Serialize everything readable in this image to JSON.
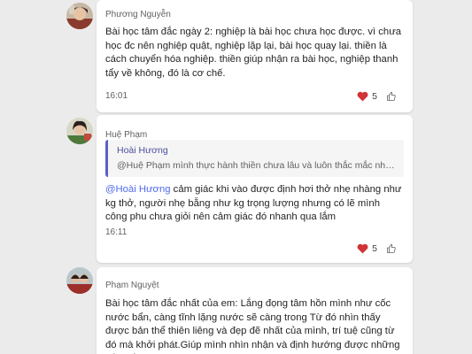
{
  "messages": [
    {
      "author": "Phương Nguyễn",
      "text": "Bài học tâm đắc ngày 2: nghiệp là bài học chưa học được. vì chưa học đc nên nghiệp quật, nghiệp lặp lại, bài học quay lại. thiền là cách chuyển hóa nghiệp. thiền giúp nhận ra bài học, nghiệp thanh tẩy về không, đó là cơ chế.",
      "time": "16:01",
      "reaction_count": "5"
    },
    {
      "author": "Huệ Phạm",
      "quote_author": "Hoài Hương",
      "quote_text": "@Huệ Phạm mình thực hành thiền chưa lâu và luôn thắc mắc như thế nà...",
      "mention": "@Hoài Hương",
      "text": " cảm giác khi vào được định hơi thở nhẹ nhàng như kg thở, người nhẹ bẵng như kg trọng lượng nhưng có lẽ mình công phu chưa giỏi nên cảm giác đó nhanh qua lắm",
      "time": "16:11",
      "reaction_count": "5"
    },
    {
      "author": "Phạm Nguyệt",
      "text": "Bài học tâm đắc nhất của em: Lắng đọng tâm hồn mình như cốc nước bẩn, càng tĩnh lặng nước sẽ càng trong Từ đó nhìn thấy được bản thể thiên liêng và đẹp đẽ nhất của mình, trí tuệ cũng từ đó mà khởi phát.Giúp mình nhìn nhận và định hướng được những điều tốt và bước đi trên đó"
    }
  ],
  "colors": {
    "accent": "#5b5fc7",
    "mention": "#4f6bed",
    "heart": "#d13438"
  },
  "icons": {
    "reaction": "heart-icon",
    "react": "like-icon"
  }
}
